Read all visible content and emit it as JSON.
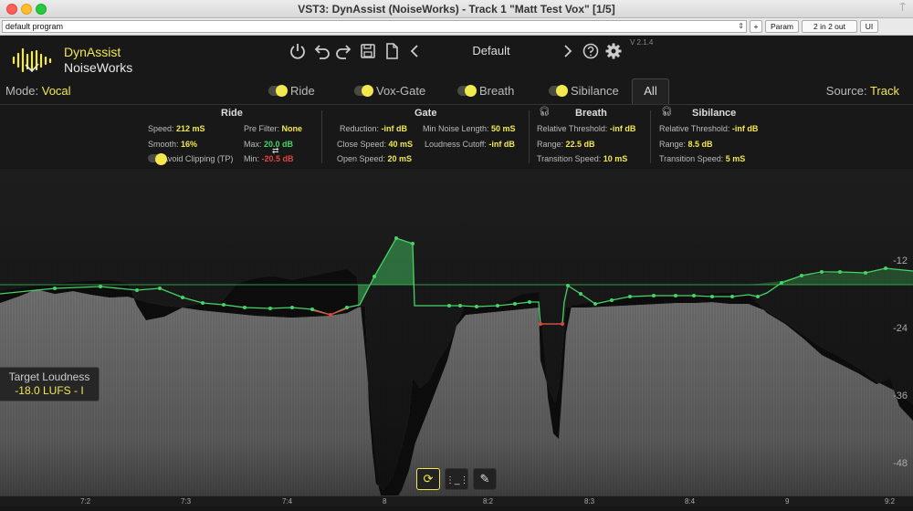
{
  "window": {
    "title": "VST3: DynAssist (NoiseWorks) - Track 1 \"Matt Test Vox\" [1/5]"
  },
  "host": {
    "program": "default program",
    "buttons": [
      "+",
      "Param",
      "2 in 2 out",
      "UI"
    ]
  },
  "brand": {
    "line1": "DynAssist",
    "line2": "NoiseWorks"
  },
  "preset": {
    "name": "Default",
    "version": "V 2.1.4"
  },
  "mode": {
    "label": "Mode: ",
    "value": "Vocal"
  },
  "source": {
    "label": "Source: ",
    "value": "Track"
  },
  "tabs": [
    "Ride",
    "Vox-Gate",
    "Breath",
    "Sibilance",
    "All"
  ],
  "ride": {
    "title": "Ride",
    "speed_label": "Speed: ",
    "speed": "212 mS",
    "smooth_label": "Smooth: ",
    "smooth": "16%",
    "avoid_label": "Avoid Clipping (TP)",
    "prefilter_label": "Pre Filter: ",
    "prefilter": "None",
    "max_label": "Max: ",
    "max": "20.0 dB",
    "min_label": "Min: ",
    "min": "-20.5 dB"
  },
  "gate": {
    "title": "Gate",
    "reduction_label": "Reduction: ",
    "reduction": "-inf dB",
    "close_label": "Close Speed: ",
    "close": "40 mS",
    "open_label": "Open Speed: ",
    "open": "20 mS",
    "minnoise_label": "Min Noise Length: ",
    "minnoise": "50 mS",
    "cutoff_label": "Loudness Cutoff: ",
    "cutoff": "-inf dB"
  },
  "breath": {
    "title": "Breath",
    "thr_label": "Relative Threshold: ",
    "thr": "-inf dB",
    "range_label": "Range: ",
    "range": "22.5 dB",
    "trans_label": "Transition Speed: ",
    "trans": "10 mS"
  },
  "sibilance": {
    "title": "Sibilance",
    "thr_label": "Relative Threshold: ",
    "thr": "-inf dB",
    "range_label": "Range: ",
    "range": "8.5 dB",
    "trans_label": "Transition Speed: ",
    "trans": "5 mS"
  },
  "target": {
    "label": "Target Loudness",
    "value": "-18.0 LUFS - I"
  },
  "db_scale": [
    "-12",
    "-24",
    "-36",
    "-48"
  ],
  "timeline": [
    "7:2",
    "7:3",
    "7:4",
    "8",
    "8:2",
    "8:3",
    "8:4",
    "9",
    "9:2"
  ],
  "colors": {
    "accent": "#f3e94e",
    "green": "#46d466",
    "red": "#e6433b",
    "waveform": "#6a6a6a"
  }
}
